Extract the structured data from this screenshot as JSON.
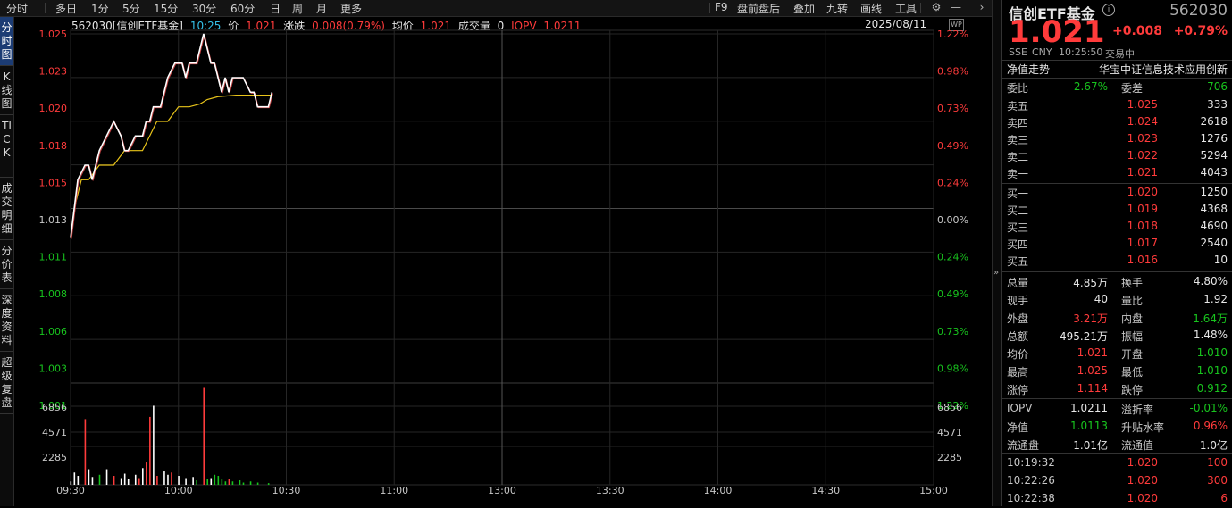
{
  "toolbar": {
    "left_tabs": [
      "分时",
      "多日",
      "1分",
      "5分",
      "15分",
      "30分",
      "60分",
      "日",
      "周",
      "月",
      "更多"
    ],
    "right_tabs": [
      "F9",
      "盘前盘后",
      "叠加",
      "九转",
      "画线",
      "工具"
    ]
  },
  "side_tabs": [
    "分时图",
    "K线图",
    "TICK",
    "成交明细",
    "分价表",
    "深度资料",
    "超级复盘"
  ],
  "info": {
    "code_name": "562030[信创ETF基金]",
    "time": "10:25",
    "price_label": "价",
    "price": "1.021",
    "change_label": "涨跌",
    "change": "0.008(0.79%)",
    "avg_label": "均价",
    "avg": "1.021",
    "vol_label": "成交量",
    "vol": "0",
    "iopv_label": "IOPV",
    "iopv": "1.0211",
    "date": "2025/08/11"
  },
  "colors": {
    "up": "#ff3b3b",
    "down": "#18c41e",
    "price_line": "#ffffff",
    "avg_line": "#e8c41a",
    "grid": "#2a2a2a"
  },
  "quote": {
    "name": "信创ETF基金",
    "code": "562030",
    "price": "1.021",
    "change": "+0.008",
    "change_pct": "+0.79%",
    "market": "SSE",
    "currency": "CNY",
    "time": "10:25:50",
    "status": "交易中",
    "nav_trend_label": "净值走势",
    "index_name": "华宝中证信息技术应用创新"
  },
  "book_summary": {
    "wb_label": "委比",
    "wb": "-2.67%",
    "wc_label": "委差",
    "wc": "-706"
  },
  "asks": [
    {
      "label": "卖五",
      "price": "1.025",
      "vol": "333"
    },
    {
      "label": "卖四",
      "price": "1.024",
      "vol": "2618"
    },
    {
      "label": "卖三",
      "price": "1.023",
      "vol": "1276"
    },
    {
      "label": "卖二",
      "price": "1.022",
      "vol": "5294"
    },
    {
      "label": "卖一",
      "price": "1.021",
      "vol": "4043"
    }
  ],
  "bids": [
    {
      "label": "买一",
      "price": "1.020",
      "vol": "1250"
    },
    {
      "label": "买二",
      "price": "1.019",
      "vol": "4368"
    },
    {
      "label": "买三",
      "price": "1.018",
      "vol": "4690"
    },
    {
      "label": "买四",
      "price": "1.017",
      "vol": "2540"
    },
    {
      "label": "买五",
      "price": "1.016",
      "vol": "10"
    }
  ],
  "stats": [
    {
      "l1": "总量",
      "v1": "4.85万",
      "c1": "wh",
      "l2": "换手",
      "v2": "4.80%",
      "c2": "wh"
    },
    {
      "l1": "现手",
      "v1": "40",
      "c1": "wh",
      "l2": "量比",
      "v2": "1.92",
      "c2": "wh"
    },
    {
      "l1": "外盘",
      "v1": "3.21万",
      "c1": "up",
      "l2": "内盘",
      "v2": "1.64万",
      "c2": "dn"
    },
    {
      "l1": "总额",
      "v1": "495.21万",
      "c1": "wh",
      "l2": "振幅",
      "v2": "1.48%",
      "c2": "wh"
    },
    {
      "l1": "均价",
      "v1": "1.021",
      "c1": "up",
      "l2": "开盘",
      "v2": "1.010",
      "c2": "dn"
    },
    {
      "l1": "最高",
      "v1": "1.025",
      "c1": "up",
      "l2": "最低",
      "v2": "1.010",
      "c2": "dn"
    },
    {
      "l1": "涨停",
      "v1": "1.114",
      "c1": "up",
      "l2": "跌停",
      "v2": "0.912",
      "c2": "dn"
    }
  ],
  "stats2": [
    {
      "l1": "IOPV",
      "v1": "1.0211",
      "c1": "wh",
      "l2": "溢折率",
      "v2": "-0.01%",
      "c2": "dn"
    },
    {
      "l1": "净值",
      "v1": "1.0113",
      "c1": "dn",
      "l2": "升贴水率",
      "v2": "0.96%",
      "c2": "up"
    },
    {
      "l1": "流通盘",
      "v1": "1.01亿",
      "c1": "wh",
      "l2": "流通值",
      "v2": "1.0亿",
      "c2": "wh"
    }
  ],
  "trades": [
    {
      "time": "10:19:32",
      "price": "1.020",
      "vol": "100",
      "c": "up"
    },
    {
      "time": "10:22:26",
      "price": "1.020",
      "vol": "300",
      "c": "up"
    },
    {
      "time": "10:22:38",
      "price": "1.020",
      "vol": "6",
      "c": "up"
    }
  ],
  "chart_data": {
    "type": "line",
    "prev_close": 1.013,
    "price_ticks_up": [
      "1.025",
      "1.023",
      "1.020",
      "1.018",
      "1.015"
    ],
    "price_tick_mid": "1.013",
    "price_ticks_dn": [
      "1.011",
      "1.008",
      "1.006",
      "1.003",
      "1.001"
    ],
    "pct_ticks_up": [
      "1.22%",
      "0.98%",
      "0.73%",
      "0.49%",
      "0.24%"
    ],
    "pct_tick_mid": "0.00%",
    "pct_ticks_dn": [
      "0.24%",
      "0.49%",
      "0.73%",
      "0.98%",
      "1.22%"
    ],
    "vol_ticks": [
      "6856",
      "4571",
      "2285"
    ],
    "time_ticks": [
      "09:30",
      "10:00",
      "10:30",
      "11:00",
      "13:00",
      "13:30",
      "14:00",
      "14:30",
      "15:00"
    ],
    "ylim": [
      1.001,
      1.025
    ],
    "vol_max": 9140,
    "price_series": [
      [
        0,
        1.011
      ],
      [
        2,
        1.015
      ],
      [
        4,
        1.016
      ],
      [
        5,
        1.016
      ],
      [
        6,
        1.015
      ],
      [
        7,
        1.016
      ],
      [
        8,
        1.017
      ],
      [
        10,
        1.018
      ],
      [
        12,
        1.019
      ],
      [
        14,
        1.018
      ],
      [
        15,
        1.017
      ],
      [
        16,
        1.017
      ],
      [
        18,
        1.018
      ],
      [
        20,
        1.018
      ],
      [
        21,
        1.019
      ],
      [
        22,
        1.019
      ],
      [
        23,
        1.02
      ],
      [
        25,
        1.02
      ],
      [
        27,
        1.022
      ],
      [
        29,
        1.023
      ],
      [
        31,
        1.023
      ],
      [
        32,
        1.022
      ],
      [
        33,
        1.023
      ],
      [
        35,
        1.023
      ],
      [
        36,
        1.024
      ],
      [
        37,
        1.025
      ],
      [
        38,
        1.024
      ],
      [
        39,
        1.023
      ],
      [
        40,
        1.023
      ],
      [
        41,
        1.022
      ],
      [
        42,
        1.021
      ],
      [
        43,
        1.022
      ],
      [
        44,
        1.021
      ],
      [
        45,
        1.022
      ],
      [
        46,
        1.022
      ],
      [
        48,
        1.022
      ],
      [
        50,
        1.021
      ],
      [
        51,
        1.021
      ],
      [
        52,
        1.02
      ],
      [
        54,
        1.02
      ],
      [
        55,
        1.02
      ],
      [
        56,
        1.021
      ]
    ],
    "avg_series": [
      [
        0,
        1.011
      ],
      [
        1,
        1.013
      ],
      [
        3,
        1.015
      ],
      [
        5,
        1.015
      ],
      [
        8,
        1.016
      ],
      [
        10,
        1.016
      ],
      [
        12,
        1.016
      ],
      [
        15,
        1.017
      ],
      [
        18,
        1.017
      ],
      [
        20,
        1.017
      ],
      [
        22,
        1.018
      ],
      [
        24,
        1.019
      ],
      [
        27,
        1.019
      ],
      [
        30,
        1.02
      ],
      [
        33,
        1.02
      ],
      [
        36,
        1.0202
      ],
      [
        38,
        1.0205
      ],
      [
        41,
        1.0207
      ],
      [
        46,
        1.0208
      ],
      [
        50,
        1.0208
      ],
      [
        56,
        1.0208
      ]
    ],
    "volume": [
      {
        "t": 0,
        "v": 300,
        "c": "w"
      },
      {
        "t": 1,
        "v": 1100,
        "c": "w"
      },
      {
        "t": 2,
        "v": 800,
        "c": "w"
      },
      {
        "t": 4,
        "v": 5900,
        "c": "r"
      },
      {
        "t": 5,
        "v": 1400,
        "c": "w"
      },
      {
        "t": 6,
        "v": 700,
        "c": "w"
      },
      {
        "t": 8,
        "v": 900,
        "c": "g"
      },
      {
        "t": 10,
        "v": 1400,
        "c": "w"
      },
      {
        "t": 12,
        "v": 800,
        "c": "r"
      },
      {
        "t": 14,
        "v": 600,
        "c": "w"
      },
      {
        "t": 15,
        "v": 1000,
        "c": "w"
      },
      {
        "t": 16,
        "v": 500,
        "c": "w"
      },
      {
        "t": 18,
        "v": 900,
        "c": "w"
      },
      {
        "t": 19,
        "v": 600,
        "c": "r"
      },
      {
        "t": 20,
        "v": 1500,
        "c": "w"
      },
      {
        "t": 21,
        "v": 2000,
        "c": "r"
      },
      {
        "t": 22,
        "v": 6100,
        "c": "r"
      },
      {
        "t": 23,
        "v": 7100,
        "c": "w"
      },
      {
        "t": 24,
        "v": 800,
        "c": "r"
      },
      {
        "t": 26,
        "v": 1200,
        "c": "w"
      },
      {
        "t": 27,
        "v": 900,
        "c": "w"
      },
      {
        "t": 28,
        "v": 1100,
        "c": "r"
      },
      {
        "t": 30,
        "v": 800,
        "c": "w"
      },
      {
        "t": 32,
        "v": 600,
        "c": "w"
      },
      {
        "t": 34,
        "v": 700,
        "c": "w"
      },
      {
        "t": 35,
        "v": 400,
        "c": "g"
      },
      {
        "t": 37,
        "v": 8700,
        "c": "r"
      },
      {
        "t": 38,
        "v": 500,
        "c": "g"
      },
      {
        "t": 39,
        "v": 600,
        "c": "w"
      },
      {
        "t": 40,
        "v": 900,
        "c": "g"
      },
      {
        "t": 41,
        "v": 800,
        "c": "g"
      },
      {
        "t": 42,
        "v": 500,
        "c": "g"
      },
      {
        "t": 43,
        "v": 300,
        "c": "g"
      },
      {
        "t": 44,
        "v": 500,
        "c": "r"
      },
      {
        "t": 45,
        "v": 300,
        "c": "g"
      },
      {
        "t": 47,
        "v": 400,
        "c": "g"
      },
      {
        "t": 48,
        "v": 200,
        "c": "g"
      },
      {
        "t": 50,
        "v": 300,
        "c": "g"
      },
      {
        "t": 52,
        "v": 200,
        "c": "g"
      },
      {
        "t": 55,
        "v": 150,
        "c": "g"
      }
    ]
  }
}
